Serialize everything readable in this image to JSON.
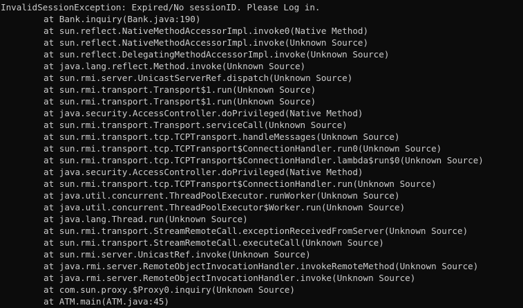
{
  "terminal": {
    "exception_header": "InvalidSessionException: Expired/No sessionID. Please Log in.",
    "frames": [
      "at Bank.inquiry(Bank.java:190)",
      "at sun.reflect.NativeMethodAccessorImpl.invoke0(Native Method)",
      "at sun.reflect.NativeMethodAccessorImpl.invoke(Unknown Source)",
      "at sun.reflect.DelegatingMethodAccessorImpl.invoke(Unknown Source)",
      "at java.lang.reflect.Method.invoke(Unknown Source)",
      "at sun.rmi.server.UnicastServerRef.dispatch(Unknown Source)",
      "at sun.rmi.transport.Transport$1.run(Unknown Source)",
      "at sun.rmi.transport.Transport$1.run(Unknown Source)",
      "at java.security.AccessController.doPrivileged(Native Method)",
      "at sun.rmi.transport.Transport.serviceCall(Unknown Source)",
      "at sun.rmi.transport.tcp.TCPTransport.handleMessages(Unknown Source)",
      "at sun.rmi.transport.tcp.TCPTransport$ConnectionHandler.run0(Unknown Source)",
      "at sun.rmi.transport.tcp.TCPTransport$ConnectionHandler.lambda$run$0(Unknown Source)",
      "at java.security.AccessController.doPrivileged(Native Method)",
      "at sun.rmi.transport.tcp.TCPTransport$ConnectionHandler.run(Unknown Source)",
      "at java.util.concurrent.ThreadPoolExecutor.runWorker(Unknown Source)",
      "at java.util.concurrent.ThreadPoolExecutor$Worker.run(Unknown Source)",
      "at java.lang.Thread.run(Unknown Source)",
      "at sun.rmi.transport.StreamRemoteCall.exceptionReceivedFromServer(Unknown Source)",
      "at sun.rmi.transport.StreamRemoteCall.executeCall(Unknown Source)",
      "at sun.rmi.server.UnicastRef.invoke(Unknown Source)",
      "at java.rmi.server.RemoteObjectInvocationHandler.invokeRemoteMethod(Unknown Source)",
      "at java.rmi.server.RemoteObjectInvocationHandler.invoke(Unknown Source)",
      "at com.sun.proxy.$Proxy0.inquiry(Unknown Source)",
      "at ATM.main(ATM.java:45)"
    ],
    "colors": {
      "background": "#0c0c0c",
      "text": "#cccccc"
    }
  }
}
